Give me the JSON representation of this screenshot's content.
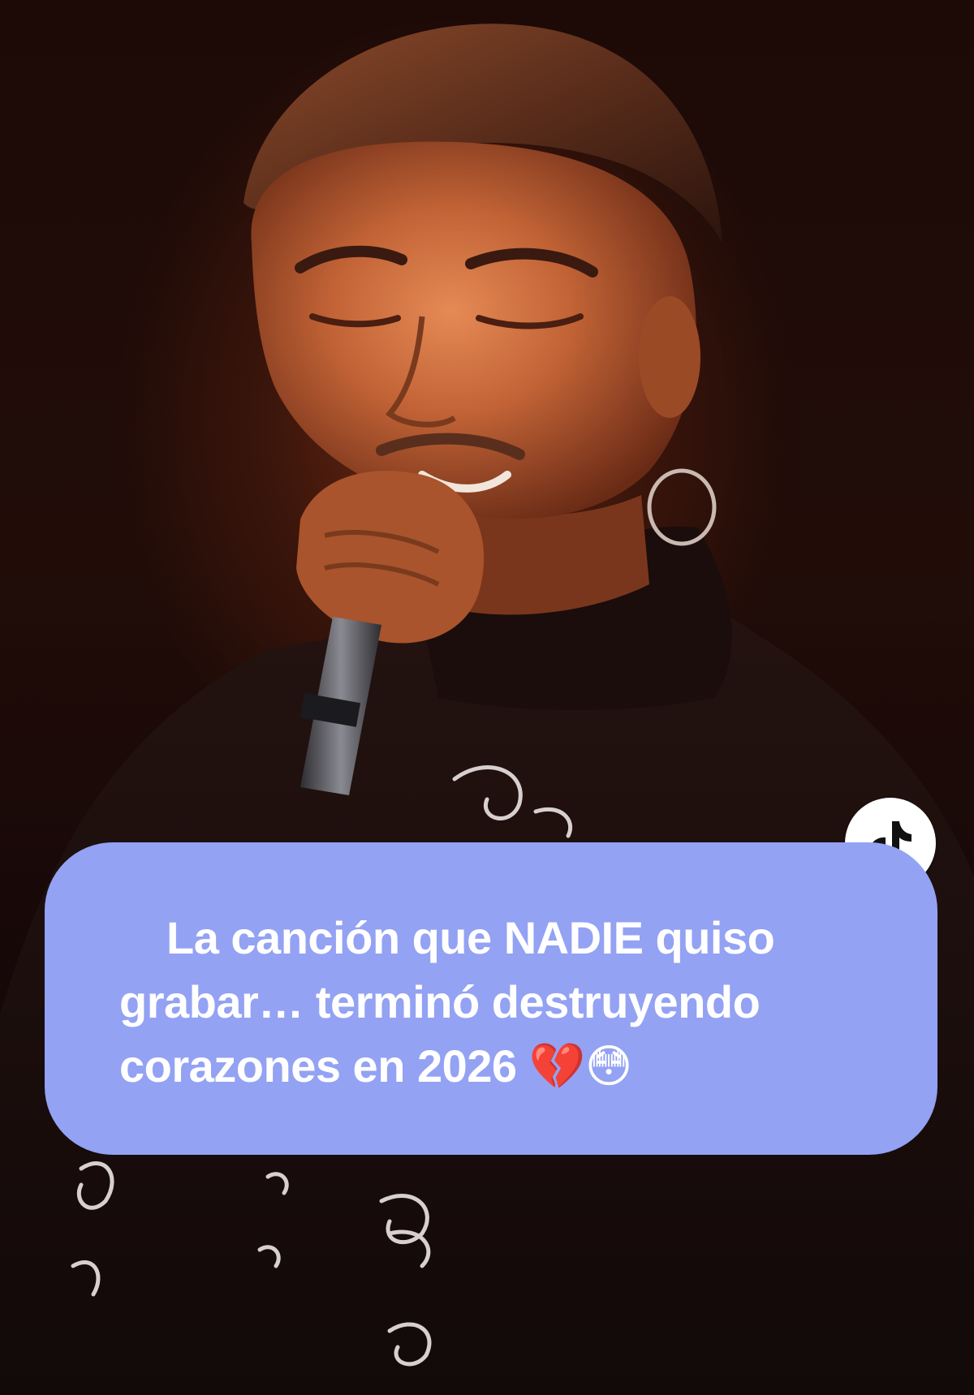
{
  "caption": {
    "text": "La canción que NADIE quiso grabar… terminó destruyendo corazones en 2026 💔😳",
    "background_color": "#93a2f3",
    "text_color": "#ffffff"
  },
  "badge": {
    "icon": "tiktok-logo-icon"
  },
  "photo": {
    "subject": "singer-with-microphone",
    "dominant_colors": [
      "#1d0a07",
      "#6e2a12",
      "#c8653a"
    ]
  }
}
